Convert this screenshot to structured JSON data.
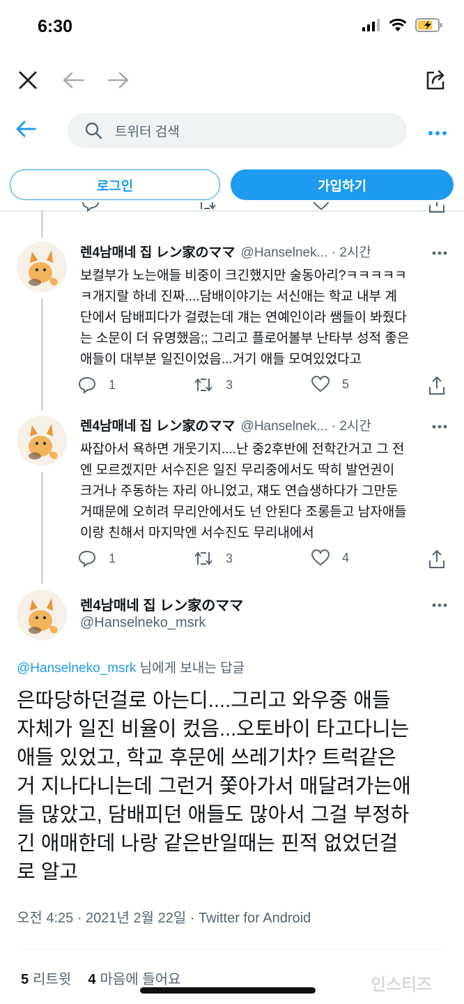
{
  "status_bar": {
    "time": "6:30"
  },
  "search": {
    "placeholder": "트위터 검색"
  },
  "auth": {
    "login_label": "로그인",
    "signup_label": "가입하기"
  },
  "reply_tweets": [
    {
      "display_name": "렌4남매네 집 レン家のママ",
      "handle": "@Hanselnek...",
      "time": "· 2시간",
      "lines": [
        "보컬부가 노는애들 비중이 크긴했지만 술동아리?ㅋㅋㅋㅋㅋ",
        "ㅋ개지랄 하네 진짜....담배이야기는 서신애는 학교 내부 계",
        "단에서 담배피다가 걸렸는데 걔는 연예인이라 쌤들이 봐줬다",
        "는 소문이 더 유명했음;; 그리고 플로어볼부 난타부 성적 좋은",
        "애들이 대부분 일진이었음...거기 애들 모여있었다고"
      ],
      "replies": "1",
      "retweets": "3",
      "likes": "5"
    },
    {
      "display_name": "렌4남매네 집 レン家のママ",
      "handle": "@Hanselnek...",
      "time": "· 2시간",
      "lines": [
        "싸잡아서 욕하면 개웃기지....난 중2후반에 전학간거고 그 전",
        "엔 모르겠지만 서수진은 일진 무리중에서도 딱히 발언권이",
        "크거나 주동하는 자리 아니었고, 쟤도 연습생하다가 그만둔",
        "거때문에 오히려 무리안에서도 넌 안된다 조롱듣고 남자애들",
        "이랑 친해서 마지막엔 서수진도 무리내에서"
      ],
      "replies": "1",
      "retweets": "3",
      "likes": "4"
    }
  ],
  "main_tweet": {
    "display_name": "렌4남매네 집 レン家のママ",
    "handle": "@Hanselneko_msrk",
    "reply_to_mention": "@Hanselneko_msrk",
    "reply_to_suffix": " 님에게 보내는 답글",
    "lines": [
      "은따당하던걸로 아는디....그리고 와우중 애들",
      "자체가 일진 비율이 컸음...오토바이 타고다니는",
      "애들 있었고, 학교 후문에 쓰레기차? 트럭같은",
      "거 지나다니는데 그런거 쫓아가서 매달려가는애",
      "들 많았고, 담배피던 애들도 많아서 그걸 부정하",
      "긴 애매한데 나랑 같은반일때는 핀적 없었던걸",
      "로 알고"
    ],
    "timestamp": "오전 4:25 · 2021년 2월 22일 · Twitter for Android",
    "retweet_count": "5",
    "retweet_label": "리트윗",
    "like_count": "4",
    "like_label": "마음에 들어요"
  },
  "watermark": "인스티즈",
  "colors": {
    "accent": "#1d9bf0",
    "muted": "#536471",
    "divider": "#cfd9de"
  }
}
